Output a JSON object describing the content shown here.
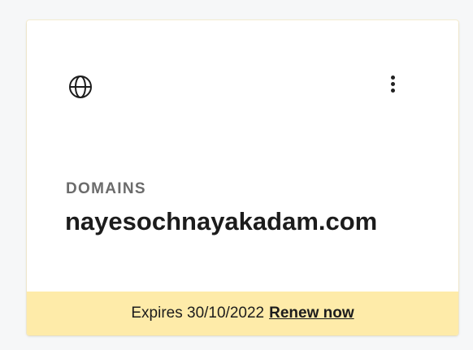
{
  "card": {
    "icon": "globe-icon",
    "menu_icon": "vertical-ellipsis-icon",
    "category": "DOMAINS",
    "domain": "nayesochnayakadam.com",
    "footer": {
      "expires_text": "Expires 30/10/2022",
      "renew_label": "Renew now"
    }
  },
  "colors": {
    "background": "#f6f7f8",
    "card": "#ffffff",
    "footer_background": "#feeba9",
    "category_text": "#6b6b6b",
    "primary_text": "#1c1c1c"
  }
}
